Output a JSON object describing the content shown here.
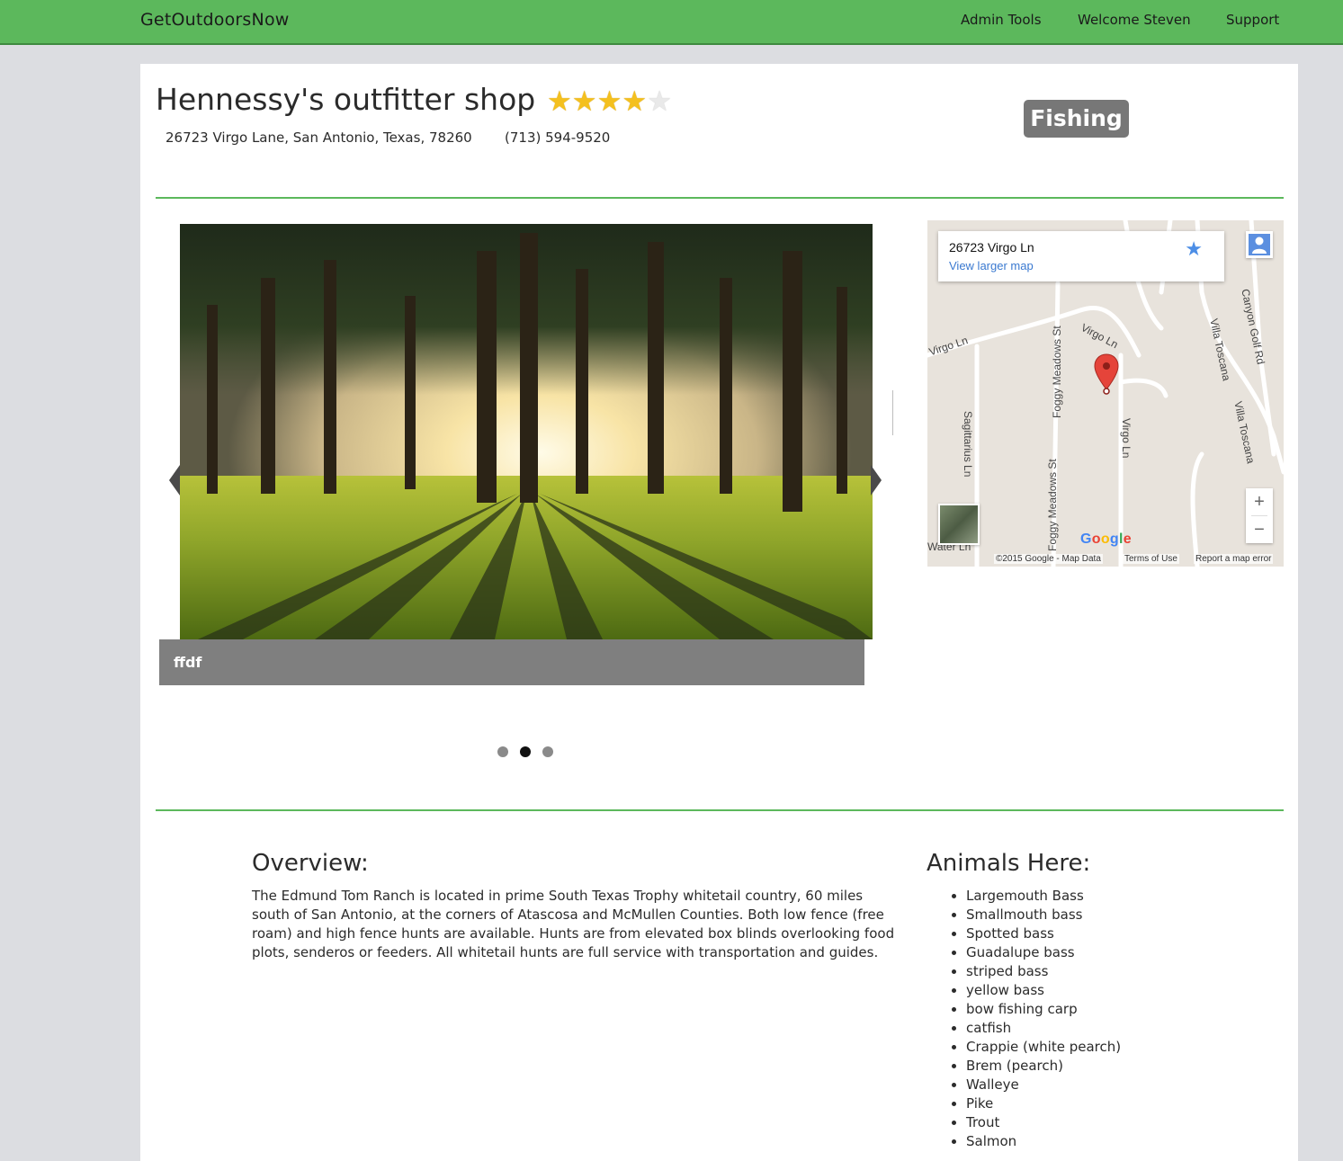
{
  "nav": {
    "brand": "GetOutdoorsNow",
    "links": [
      "Admin Tools",
      "Welcome Steven",
      "Support"
    ]
  },
  "listing": {
    "title": "Hennessy's outfitter shop",
    "rating": 4,
    "rating_max": 5,
    "address": "26723 Virgo Lane, San Antonio, Texas, 78260",
    "phone": "(713) 594-9520",
    "category": "Fishing"
  },
  "carousel": {
    "caption": "ffdf",
    "slide_count": 3,
    "active_index": 1
  },
  "map": {
    "place": "26723 Virgo Ln",
    "view_larger": "View larger map",
    "google": "Google",
    "copyright": "©2015 Google - Map Data",
    "terms": "Terms of Use",
    "report": "Report a map error",
    "zoom_in": "+",
    "zoom_out": "−",
    "streets": [
      "Virgo Ln",
      "Virgo Ln",
      "Foggy Meadows St",
      "Foggy Meadows St",
      "Sagittarius Ln",
      "Villa Toscana",
      "Villa Toscana",
      "Canyon Golf Rd",
      "Virgo Ln",
      "Water Ln"
    ]
  },
  "overview": {
    "heading": "Overview:",
    "text": "The Edmund Tom Ranch is located in prime South Texas Trophy whitetail country, 60 miles south of San Antonio, at the corners of Atascosa and McMullen Counties. Both low fence (free roam) and high fence hunts are available. Hunts are from elevated box blinds overlooking food plots, senderos or feeders. All whitetail hunts are full service with transportation and guides."
  },
  "animals": {
    "heading": "Animals Here:",
    "items": [
      "Largemouth Bass",
      "Smallmouth bass",
      "Spotted bass",
      "Guadalupe bass",
      "striped bass",
      "yellow bass",
      "bow fishing carp",
      "catfish",
      "Crappie (white pearch)",
      "Brem (pearch)",
      "Walleye",
      "Pike",
      "Trout",
      "Salmon"
    ]
  },
  "colors": {
    "nav": "#5cb85c",
    "accent_line": "#5cb85c",
    "badge": "#777777",
    "star": "#f4c01e"
  }
}
